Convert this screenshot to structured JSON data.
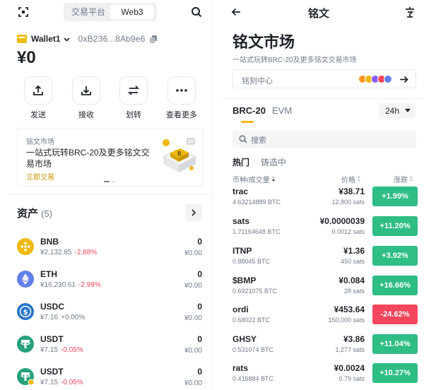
{
  "left": {
    "header": {
      "tabs": [
        "交易平台",
        "Web3"
      ],
      "active_tab": "Web3"
    },
    "wallet": {
      "name": "Wallet1",
      "address": "0xB236...8Ab9e6",
      "balance": "¥0"
    },
    "actions": [
      {
        "label": "发送",
        "icon": "upload-icon"
      },
      {
        "label": "接收",
        "icon": "download-icon"
      },
      {
        "label": "划转",
        "icon": "transfer-icon"
      },
      {
        "label": "查看更多",
        "icon": "more-icon"
      }
    ],
    "promo": {
      "eyebrow": "铭文市场",
      "headline": "一站式玩转BRC-20及更多铭文交易市场",
      "cta": "立即交易"
    },
    "assets": {
      "title": "资产",
      "count": "(5)",
      "items": [
        {
          "symbol": "BNB",
          "price": "¥2,132.85",
          "change": "-2.88%",
          "dir": "down",
          "amount": "0",
          "value": "¥0.00",
          "color": "#f0b90b"
        },
        {
          "symbol": "ETH",
          "price": "¥16,230.61",
          "change": "-2.99%",
          "dir": "down",
          "amount": "0",
          "value": "¥0.00",
          "color": "#627eea"
        },
        {
          "symbol": "USDC",
          "price": "¥7.16",
          "change": "+0.00%",
          "dir": "flat",
          "amount": "0",
          "value": "¥0.00",
          "color": "#2775ca"
        },
        {
          "symbol": "USDT",
          "price": "¥7.15",
          "change": "-0.05%",
          "dir": "down",
          "amount": "0",
          "value": "¥0.00",
          "color": "#26a17b"
        },
        {
          "symbol": "USDT",
          "price": "¥7.15",
          "change": "-0.05%",
          "dir": "down",
          "amount": "0",
          "value": "¥0.00",
          "color": "#26a17b"
        }
      ]
    }
  },
  "right": {
    "header": {
      "title": "铭文"
    },
    "market": {
      "title": "铭文市场",
      "subtitle": "一站式玩转BRC-20及更多铭文交易市场",
      "mint_center": "铭刻中心"
    },
    "tabs": [
      "BRC-20",
      "EVM"
    ],
    "active_tab": "BRC-20",
    "period": "24h",
    "search_placeholder": "搜索",
    "filters": [
      "热门",
      "铸造中"
    ],
    "columns": {
      "name": "币种/成交量",
      "price": "价格",
      "change": "涨跌"
    },
    "rows": [
      {
        "name": "trac",
        "volume": "4.63214889 BTC",
        "price": "¥38.71",
        "price_sats": "12,800 sats",
        "change": "+1.99%",
        "dir": "up"
      },
      {
        "name": "sats",
        "volume": "1.71164648 BTC",
        "price": "¥0.0000039",
        "price_sats": "0.0012 sats",
        "change": "+11.20%",
        "dir": "up"
      },
      {
        "name": "ITNP",
        "volume": "0.88045 BTC",
        "price": "¥1.36",
        "price_sats": "450 sats",
        "change": "+3.92%",
        "dir": "up"
      },
      {
        "name": "$BMP",
        "volume": "0.6921075 BTC",
        "price": "¥0.084",
        "price_sats": "28 sats",
        "change": "+16.66%",
        "dir": "up"
      },
      {
        "name": "ordi",
        "volume": "0.68022 BTC",
        "price": "¥453.64",
        "price_sats": "150,000 sats",
        "change": "-24.62%",
        "dir": "down"
      },
      {
        "name": "GHSY",
        "volume": "0.531074 BTC",
        "price": "¥3.86",
        "price_sats": "1,277 sats",
        "change": "+11.04%",
        "dir": "up"
      },
      {
        "name": "rats",
        "volume": "0.416884 BTC",
        "price": "¥0.0024",
        "price_sats": "0.79 sats",
        "change": "+10.27%",
        "dir": "up"
      }
    ]
  },
  "colors": {
    "accent": "#f0b90b",
    "up": "#2ebd85",
    "down": "#f6465d",
    "muted": "#707a8a",
    "cta": "#c99400"
  }
}
